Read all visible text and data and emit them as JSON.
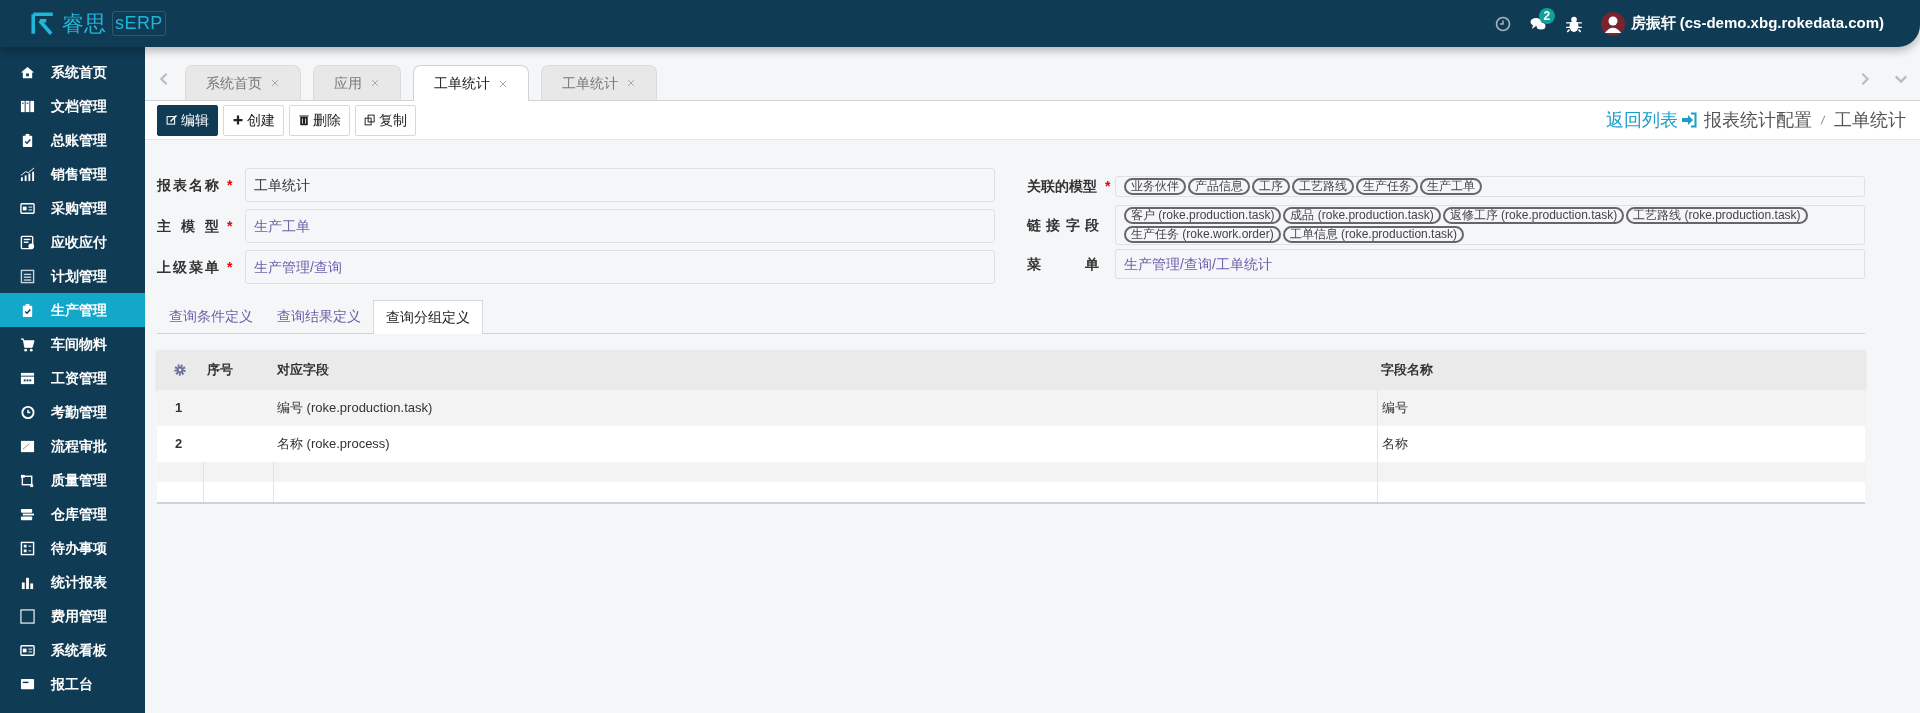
{
  "header": {
    "logo_text": "睿思",
    "logo_badge": "sERP",
    "notification_count": "2",
    "user": "房振轩 (cs-demo.xbg.rokedata.com)"
  },
  "sidebar": {
    "items": [
      {
        "label": "系统首页",
        "selected": false
      },
      {
        "label": "文档管理",
        "selected": false
      },
      {
        "label": "总账管理",
        "selected": false
      },
      {
        "label": "销售管理",
        "selected": false
      },
      {
        "label": "采购管理",
        "selected": false
      },
      {
        "label": "应收应付",
        "selected": false
      },
      {
        "label": "计划管理",
        "selected": false
      },
      {
        "label": "生产管理",
        "selected": true
      },
      {
        "label": "车间物料",
        "selected": false
      },
      {
        "label": "工资管理",
        "selected": false
      },
      {
        "label": "考勤管理",
        "selected": false
      },
      {
        "label": "流程审批",
        "selected": false
      },
      {
        "label": "质量管理",
        "selected": false
      },
      {
        "label": "仓库管理",
        "selected": false
      },
      {
        "label": "待办事项",
        "selected": false
      },
      {
        "label": "统计报表",
        "selected": false
      },
      {
        "label": "费用管理",
        "selected": false
      },
      {
        "label": "系统看板",
        "selected": false
      },
      {
        "label": "报工台",
        "selected": false
      }
    ]
  },
  "tabs": [
    {
      "label": "系统首页",
      "selected": false
    },
    {
      "label": "应用",
      "selected": false
    },
    {
      "label": "工单统计",
      "selected": true
    },
    {
      "label": "工单统计",
      "selected": false
    }
  ],
  "toolbar": {
    "buttons": [
      {
        "label": "编辑",
        "kind": "edit"
      },
      {
        "label": "创建",
        "kind": "create"
      },
      {
        "label": "删除",
        "kind": "delete"
      },
      {
        "label": "复制",
        "kind": "copy"
      }
    ],
    "back_link": "返回列表",
    "breadcrumb": [
      "报表统计配置",
      "工单统计"
    ]
  },
  "form": {
    "left": [
      {
        "label": "报表名称",
        "required_mark": "*",
        "value": "工单统计",
        "kind": "text"
      },
      {
        "label": "主模型",
        "required_mark": "*",
        "value": "生产工单",
        "kind": "link"
      },
      {
        "label": "上级菜单",
        "required_mark": "*",
        "value": "生产管理/查询",
        "kind": "link"
      }
    ],
    "right": [
      {
        "label": "关联的模型",
        "required_mark": "*",
        "kind": "tags",
        "tags": [
          "业务伙伴",
          "产品信息",
          "工序",
          "工艺路线",
          "生产任务",
          "生产工单"
        ]
      },
      {
        "label": "链接字段",
        "kind": "tags",
        "tags": [
          "客户 (roke.production.task)",
          "成品 (roke.production.task)",
          "返修工序 (roke.production.task)",
          "工艺路线 (roke.production.task)",
          "生产任务 (roke.work.order)",
          "工单信息 (roke.production.task)"
        ]
      },
      {
        "label": "菜单",
        "kind": "link",
        "value": "生产管理/查询/工单统计"
      }
    ]
  },
  "subtabs": [
    {
      "label": "查询条件定义",
      "selected": false
    },
    {
      "label": "查询结果定义",
      "selected": false
    },
    {
      "label": "查询分组定义",
      "selected": true
    }
  ],
  "table": {
    "columns": [
      "序号",
      "对应字段",
      "字段名称"
    ],
    "rows": [
      [
        "1",
        "编号 (roke.production.task)",
        "编号"
      ],
      [
        "2",
        "名称 (roke.process)",
        "名称"
      ]
    ]
  }
}
